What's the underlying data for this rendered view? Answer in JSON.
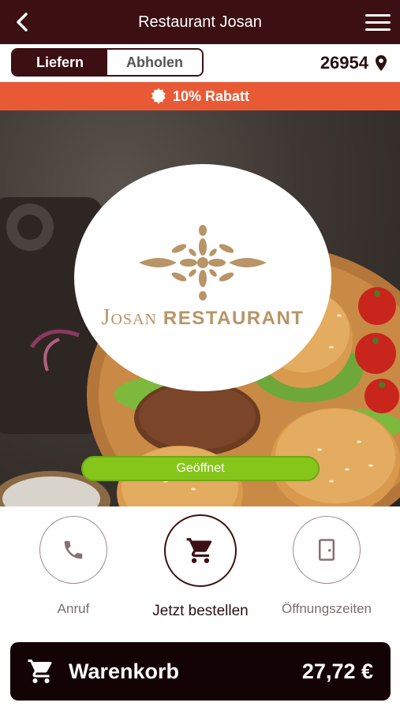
{
  "header": {
    "title": "Restaurant Josan",
    "back_icon": "chevron-left-icon",
    "menu_icon": "hamburger-menu-icon"
  },
  "order_mode": {
    "options": [
      "Liefern",
      "Abholen"
    ],
    "selected": "Liefern"
  },
  "location": {
    "zip": "26954",
    "icon": "map-pin-icon"
  },
  "promo": {
    "text": "10% Rabatt",
    "icon": "badge-icon",
    "color": "#e85a36"
  },
  "hero": {
    "logo": {
      "name_light": "Josan",
      "name_bold": "RESTAURANT"
    },
    "status": {
      "text": "Geöffnet",
      "color": "#86c61b"
    }
  },
  "actions": [
    {
      "label": "Anruf",
      "icon": "phone-icon"
    },
    {
      "label": "Jetzt bestellen",
      "icon": "cart-icon"
    },
    {
      "label": "Öffnungszeiten",
      "icon": "door-icon"
    }
  ],
  "cart": {
    "label": "Warenkorb",
    "total": "27,72 €",
    "icon": "cart-icon"
  },
  "colors": {
    "brand": "#3c0f12",
    "cart_bg": "#140304",
    "logo_gold": "#b89466"
  }
}
